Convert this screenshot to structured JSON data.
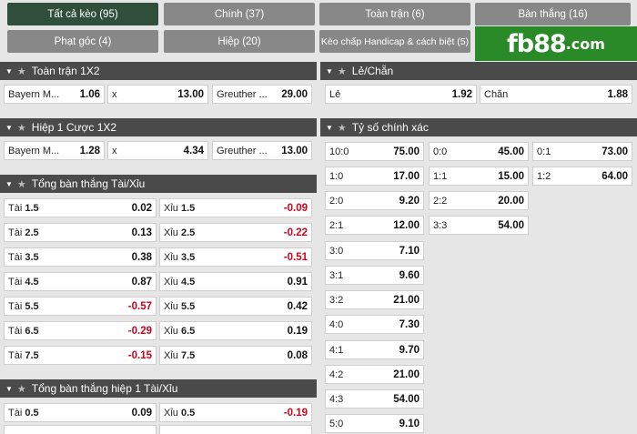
{
  "tabs": [
    {
      "label": "Tất cả kèo (95)",
      "active": true
    },
    {
      "label": "Chính (37)"
    },
    {
      "label": "Toàn trận (6)"
    },
    {
      "label": "Bàn thắng (16)"
    },
    {
      "label": "Phạt góc (4)"
    },
    {
      "label": "Hiệp (20)"
    },
    {
      "label": "Kèo chấp Handicap & cách biệt (5)"
    }
  ],
  "logo": {
    "main": "fb88",
    "suffix": ".com"
  },
  "full_match_1x2": {
    "title": "Toàn trận 1X2",
    "cells": [
      {
        "label": "Bayern M...",
        "odd": "1.06"
      },
      {
        "label": "x",
        "odd": "13.00"
      },
      {
        "label": "Greuther ...",
        "odd": "29.00"
      }
    ]
  },
  "half1_1x2": {
    "title": "Hiệp 1 Cược 1X2",
    "cells": [
      {
        "label": "Bayern M...",
        "odd": "1.28"
      },
      {
        "label": "x",
        "odd": "4.34"
      },
      {
        "label": "Greuther ...",
        "odd": "13.00"
      }
    ]
  },
  "total_goals": {
    "title": "Tổng bàn thắng Tài/Xỉu",
    "rows": [
      {
        "over_label": "Tài",
        "line": "1.5",
        "over": "0.02",
        "under_label": "Xỉu",
        "under": "-0.09"
      },
      {
        "over_label": "Tài",
        "line": "2.5",
        "over": "0.13",
        "under_label": "Xỉu",
        "under": "-0.22"
      },
      {
        "over_label": "Tài",
        "line": "3.5",
        "over": "0.38",
        "under_label": "Xỉu",
        "under": "-0.51"
      },
      {
        "over_label": "Tài",
        "line": "4.5",
        "over": "0.87",
        "under_label": "Xỉu",
        "under": "0.91"
      },
      {
        "over_label": "Tài",
        "line": "5.5",
        "over": "-0.57",
        "under_label": "Xỉu",
        "under": "0.42"
      },
      {
        "over_label": "Tài",
        "line": "6.5",
        "over": "-0.29",
        "under_label": "Xỉu",
        "under": "0.19"
      },
      {
        "over_label": "Tài",
        "line": "7.5",
        "over": "-0.15",
        "under_label": "Xỉu",
        "under": "0.08"
      }
    ]
  },
  "half1_total_goals": {
    "title": "Tổng bàn thắng hiệp 1 Tài/Xỉu",
    "rows": [
      {
        "over_label": "Tài",
        "line": "0.5",
        "over": "0.09",
        "under_label": "Xỉu",
        "under": "-0.19"
      }
    ]
  },
  "odd_even": {
    "title": "Lẻ/Chẵn",
    "cells": [
      {
        "label": "Lẻ",
        "odd": "1.92"
      },
      {
        "label": "Chẵn",
        "odd": "1.88"
      }
    ]
  },
  "correct_score": {
    "title": "Tỷ số chính xác",
    "col1": [
      {
        "label": "10:0",
        "odd": "75.00"
      },
      {
        "label": "1:0",
        "odd": "17.00"
      },
      {
        "label": "2:0",
        "odd": "9.20"
      },
      {
        "label": "2:1",
        "odd": "12.00"
      },
      {
        "label": "3:0",
        "odd": "7.10"
      },
      {
        "label": "3:1",
        "odd": "9.60"
      },
      {
        "label": "3:2",
        "odd": "21.00"
      },
      {
        "label": "4:0",
        "odd": "7.30"
      },
      {
        "label": "4:1",
        "odd": "9.70"
      },
      {
        "label": "4:2",
        "odd": "21.00"
      },
      {
        "label": "4:3",
        "odd": "54.00"
      },
      {
        "label": "5:0",
        "odd": "9.10"
      }
    ],
    "col2": [
      {
        "label": "0:0",
        "odd": "45.00"
      },
      {
        "label": "1:1",
        "odd": "15.00"
      },
      {
        "label": "2:2",
        "odd": "20.00"
      },
      {
        "label": "3:3",
        "odd": "54.00"
      }
    ],
    "col3": [
      {
        "label": "0:1",
        "odd": "73.00"
      },
      {
        "label": "1:2",
        "odd": "64.00"
      }
    ]
  },
  "colors": {
    "active_tab": "#2f4f3c",
    "tab": "#888888",
    "header": "#4a4a4a",
    "negative": "#d0021b",
    "logo_bg": "#2a8a27"
  }
}
